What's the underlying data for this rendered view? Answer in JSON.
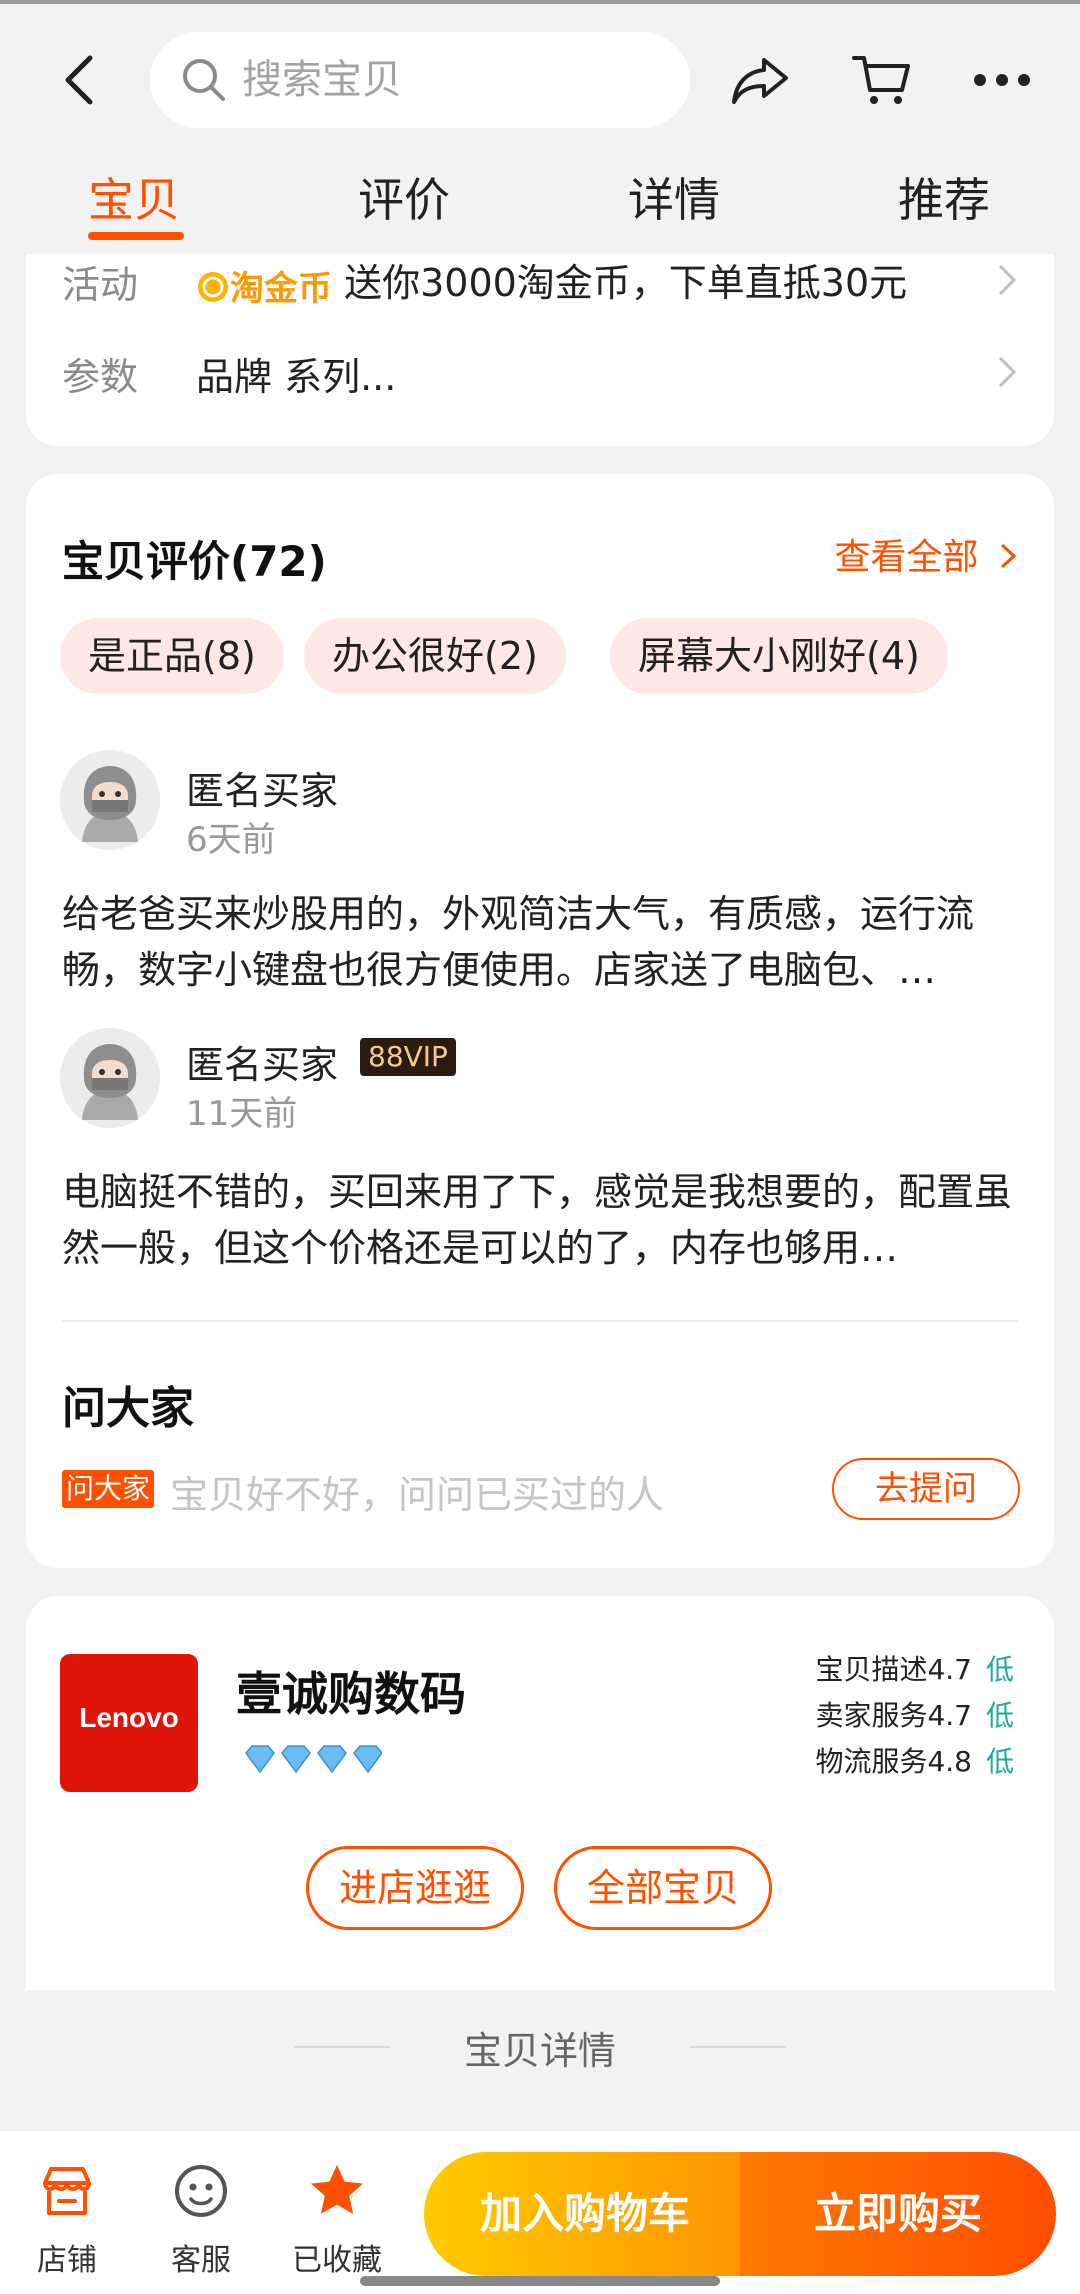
{
  "header": {
    "search_placeholder": "搜索宝贝",
    "tabs": [
      {
        "label": "宝贝",
        "active": true
      },
      {
        "label": "评价",
        "active": false
      },
      {
        "label": "详情",
        "active": false
      },
      {
        "label": "推荐",
        "active": false
      }
    ],
    "icons": [
      "back-icon",
      "search-icon",
      "share-icon",
      "cart-icon",
      "more-icon"
    ]
  },
  "info": {
    "activity_label": "活动",
    "activity_logo": "淘金币",
    "activity_text": "送你3000淘金币，下单直抵30元",
    "params_label": "参数",
    "params_text": "品牌 系列..."
  },
  "reviews": {
    "title": "宝贝评价(72)",
    "view_all": "查看全部",
    "tags": [
      "是正品(8)",
      "办公很好(2)",
      "屏幕大小刚好(4)"
    ],
    "items": [
      {
        "user": "匿名买家",
        "badge": "",
        "time": "6天前",
        "text": " 给老爸买来炒股用的，外观简洁大气，有质感，运行流畅，数字小键盘也很方便使用。店家送了电脑包、…"
      },
      {
        "user": "匿名买家",
        "badge": "88VIP",
        "time": "11天前",
        "text": "电脑挺不错的，买回来用了下，感觉是我想要的，配置虽然一般，但这个价格还是可以的了，内存也够用…"
      }
    ]
  },
  "ask": {
    "title": "问大家",
    "badge": "问大家",
    "placeholder": "宝贝好不好，问问已买过的人",
    "button": "去提问"
  },
  "shop": {
    "logo_text": "Lenovo",
    "name": "壹诚购数码",
    "diamonds": 4,
    "scores": [
      {
        "label": "宝贝描述4.7",
        "level": "低"
      },
      {
        "label": "卖家服务4.7",
        "level": "低"
      },
      {
        "label": "物流服务4.8",
        "level": "低"
      }
    ],
    "enter_button": "进店逛逛",
    "all_button": "全部宝贝"
  },
  "detail_header": "宝贝详情",
  "bottom_bar": {
    "items": [
      {
        "label": "店铺",
        "icon": "store-icon"
      },
      {
        "label": "客服",
        "icon": "customer-service-icon"
      },
      {
        "label": "已收藏",
        "icon": "star-icon"
      }
    ],
    "add_to_cart": "加入购物车",
    "buy_now": "立即购买"
  },
  "colors": {
    "accent": "#ff5000",
    "cart_gradient": [
      "#ffcb00",
      "#ff9402"
    ],
    "buy_gradient": [
      "#ff7a00",
      "#ff4e00"
    ],
    "score_level": "#1aac9f"
  }
}
